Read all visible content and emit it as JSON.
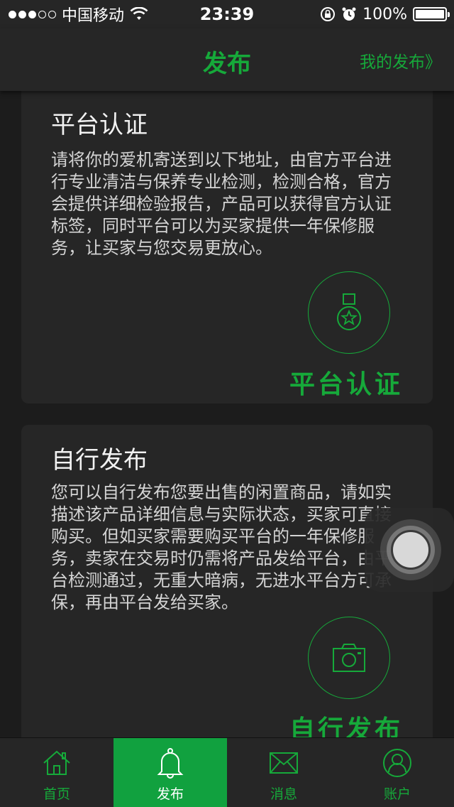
{
  "status_bar": {
    "signal_dots": [
      true,
      true,
      true,
      false,
      false
    ],
    "carrier": "中国移动",
    "time": "23:39",
    "battery_percent": "100%",
    "battery_level": 1.0
  },
  "nav": {
    "title": "发布",
    "right_link": "我的发布》"
  },
  "cards": [
    {
      "title": "平台认证",
      "description": "请将你的爱机寄送到以下地址，由官方平台进行专业清洁与保养专业检测，检测合格，官方会提供详细检验报告，产品可以获得官方认证标签，同时平台可以为买家提供一年保修服务，让买家与您交易更放心。",
      "icon": "medal-icon",
      "action_label": "平台认证"
    },
    {
      "title": "自行发布",
      "description": "您可以自行发布您要出售的闲置商品，请如实描述该产品详细信息与实际状态，买家可直接购买。但如买家需要购买平台的一年保修服务，卖家在交易时仍需将产品发给平台，由平台检测通过，无重大暗病，无进水平台方可承保，再由平台发给买家。",
      "icon": "camera-icon",
      "action_label": "自行发布"
    }
  ],
  "tabs": [
    {
      "label": "首页",
      "icon": "home-icon",
      "active": false
    },
    {
      "label": "发布",
      "icon": "bell-icon",
      "active": true
    },
    {
      "label": "消息",
      "icon": "envelope-icon",
      "active": false
    },
    {
      "label": "账户",
      "icon": "user-icon",
      "active": false
    }
  ],
  "colors": {
    "accent": "#16a93a",
    "active_tab_bg": "#11a13f",
    "background": "#1c1c1c",
    "card_bg": "#262626"
  }
}
